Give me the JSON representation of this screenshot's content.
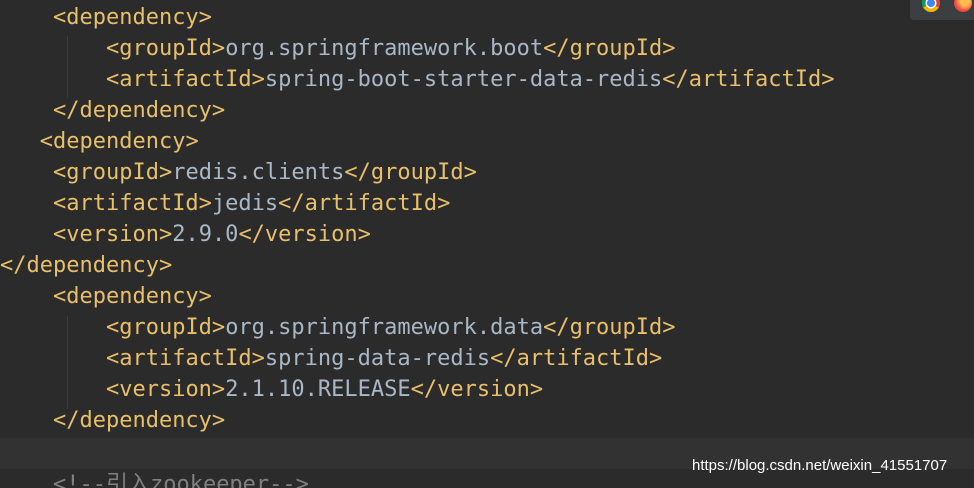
{
  "lines": [
    {
      "indent": "    ",
      "open": "<dependency>"
    },
    {
      "indent": "        ",
      "open": "<groupId>",
      "value": "org.springframework.boot",
      "close": "</groupId>"
    },
    {
      "indent": "        ",
      "open": "<artifactId>",
      "value": "spring-boot-starter-data-redis",
      "close": "</artifactId>"
    },
    {
      "indent": "    ",
      "open": "</dependency>"
    },
    {
      "indent": "   ",
      "open": "<dependency>"
    },
    {
      "indent": "    ",
      "open": "<groupId>",
      "value": "redis.clients",
      "close": "</groupId>"
    },
    {
      "indent": "    ",
      "open": "<artifactId>",
      "value": "jedis",
      "close": "</artifactId>"
    },
    {
      "indent": "    ",
      "open": "<version>",
      "value": "2.9.0",
      "close": "</version>"
    },
    {
      "indent": "",
      "open": "</dependency>"
    },
    {
      "indent": "    ",
      "open": "<dependency>"
    },
    {
      "indent": "        ",
      "open": "<groupId>",
      "value": "org.springframework.data",
      "close": "</groupId>"
    },
    {
      "indent": "        ",
      "open": "<artifactId>",
      "value": "spring-data-redis",
      "close": "</artifactId>"
    },
    {
      "indent": "        ",
      "open": "<version>",
      "value": "2.1.10.RELEASE",
      "close": "</version>"
    },
    {
      "indent": "    ",
      "open": "</dependency>"
    },
    {
      "indent": "",
      "open": ""
    },
    {
      "indent": "    ",
      "comment": "<!--引入zookeeper-->"
    }
  ],
  "watermark": "https://blog.csdn.net/weixin_41551707",
  "icons": [
    "chrome-icon",
    "firefox-icon"
  ],
  "colors": {
    "background": "#2b2b2b",
    "tag": "#e8bf6a",
    "text": "#a9b7c6",
    "comment": "#808080",
    "caret_line": "#323232"
  }
}
